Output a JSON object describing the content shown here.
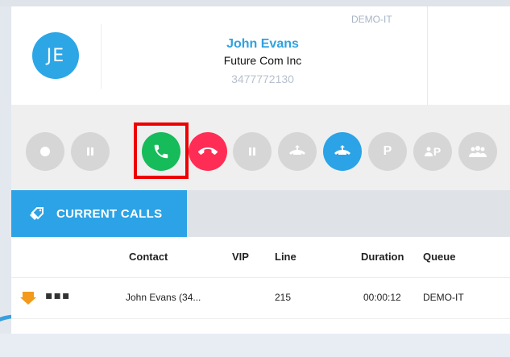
{
  "contact": {
    "initials": "JE",
    "name": "John Evans",
    "company": "Future Com Inc",
    "phone": "3477772130",
    "queue": "DEMO-IT"
  },
  "controls": [
    {
      "id": "record",
      "icon": "record-icon",
      "color": "#d6d6d6"
    },
    {
      "id": "pause",
      "icon": "pause-icon",
      "color": "#d6d6d6"
    },
    {
      "id": "answer",
      "icon": "phone-icon",
      "color": "#16bb5a",
      "highlighted": true
    },
    {
      "id": "hangup",
      "icon": "phone-hangup-icon",
      "color": "#ff2d55"
    },
    {
      "id": "hold",
      "icon": "hold-icon",
      "color": "#d6d6d6"
    },
    {
      "id": "transfer",
      "icon": "transfer-icon",
      "color": "#d6d6d6"
    },
    {
      "id": "transfer-active",
      "icon": "transfer-icon",
      "color": "#2ba3e6"
    },
    {
      "id": "park",
      "icon": "park-icon",
      "label": "P",
      "color": "#d6d6d6"
    },
    {
      "id": "user-park",
      "icon": "user-park-icon",
      "label": "P",
      "color": "#d6d6d6"
    },
    {
      "id": "conference",
      "icon": "conference-icon",
      "color": "#d6d6d6"
    }
  ],
  "tabs": {
    "current_calls": "CURRENT CALLS"
  },
  "table": {
    "headers": {
      "contact": "Contact",
      "vip": "VIP",
      "line": "Line",
      "duration": "Duration",
      "queue": "Queue"
    },
    "rows": [
      {
        "direction_icon": "incoming-call-icon",
        "menu": "▪▪▪",
        "contact": "John Evans (34...",
        "vip": "",
        "line": "215",
        "duration": "00:00:12",
        "queue": "DEMO-IT"
      }
    ]
  },
  "colors": {
    "accent": "#2ba3e6",
    "answer": "#16bb5a",
    "hangup": "#ff2d55",
    "highlight_box": "#ee0000"
  }
}
